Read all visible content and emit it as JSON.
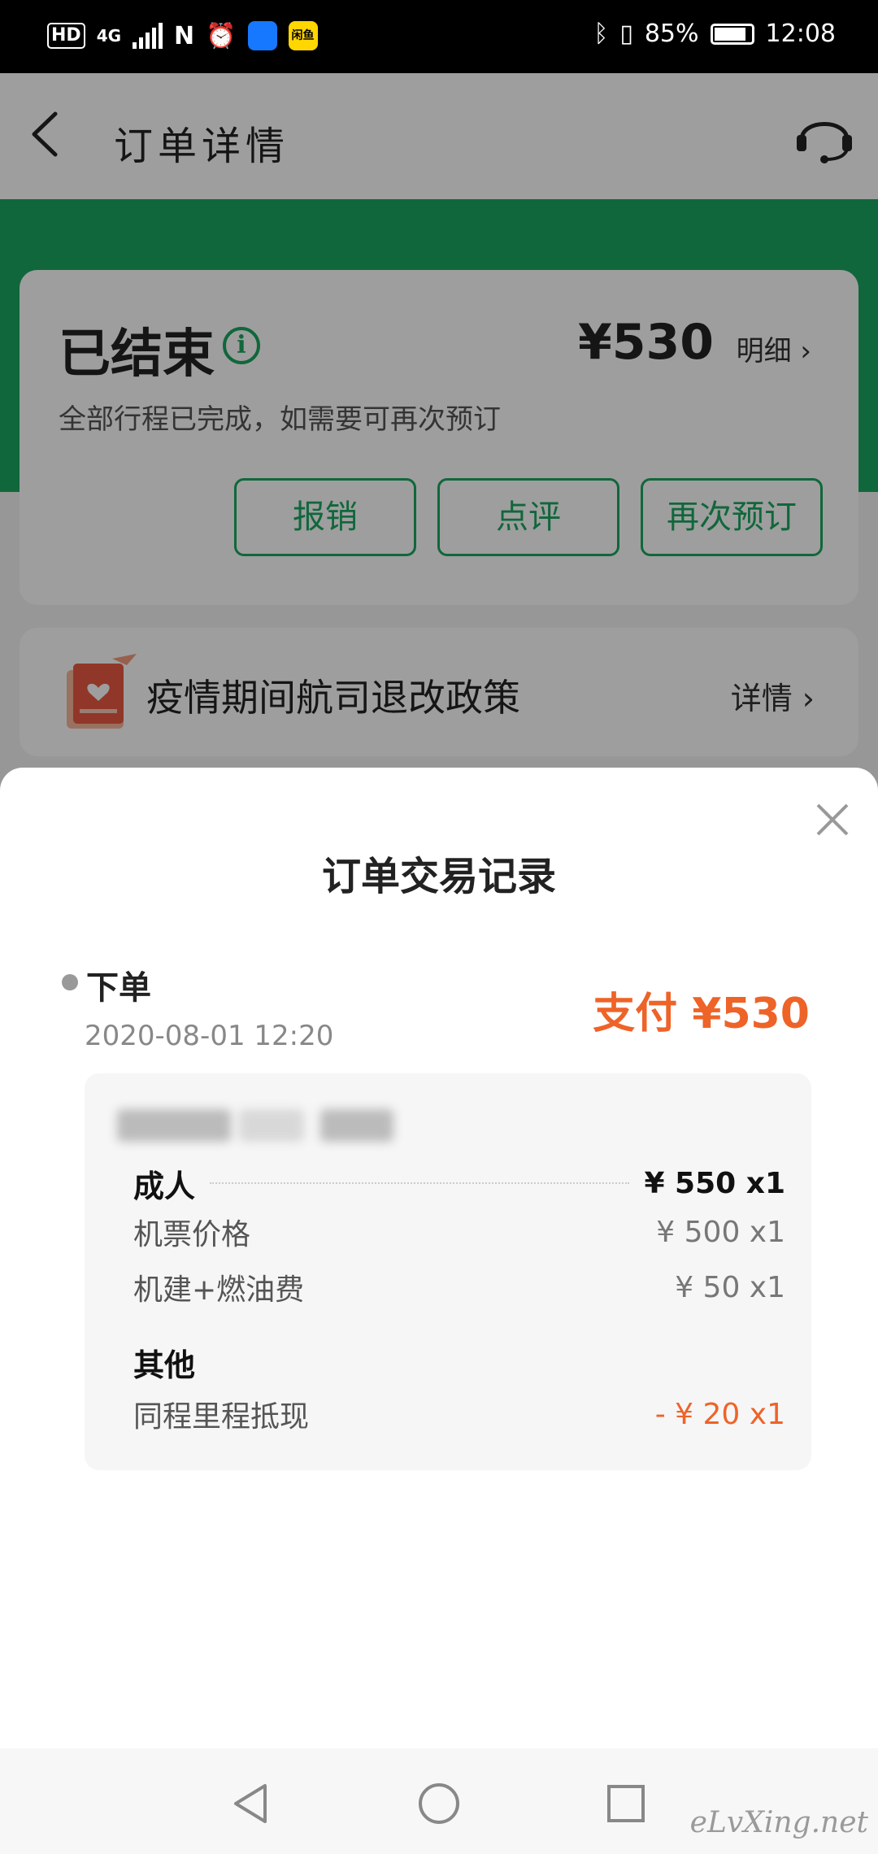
{
  "status_bar": {
    "hd": "HD",
    "network": "4G",
    "app_badge": "闲鱼",
    "battery": "85%",
    "time": "12:08"
  },
  "header": {
    "title": "订单详情"
  },
  "order": {
    "status": "已结束",
    "price": "¥530",
    "detail_link": "明细 ›",
    "subtitle": "全部行程已完成，如需要可再次预订",
    "buttons": [
      "报销",
      "点评",
      "再次预订"
    ]
  },
  "policy": {
    "text": "疫情期间航司退改政策",
    "more": "详情 ›"
  },
  "sheet": {
    "title": "订单交易记录",
    "step": "下单",
    "time": "2020-08-01 12:20",
    "pay": "支付 ¥530",
    "groups": [
      {
        "label": "成人",
        "value": "¥ 550 x1",
        "items": [
          {
            "label": "机票价格",
            "value": "¥ 500 x1"
          },
          {
            "label": "机建+燃油费",
            "value": "¥ 50 x1"
          }
        ]
      },
      {
        "label": "其他",
        "items": [
          {
            "label": "同程里程抵现",
            "value": "- ¥ 20 x1"
          }
        ]
      }
    ]
  },
  "watermark": "eLvXing.net",
  "colors": {
    "brand_green": "#1aa660",
    "accent_orange": "#ee6328"
  }
}
